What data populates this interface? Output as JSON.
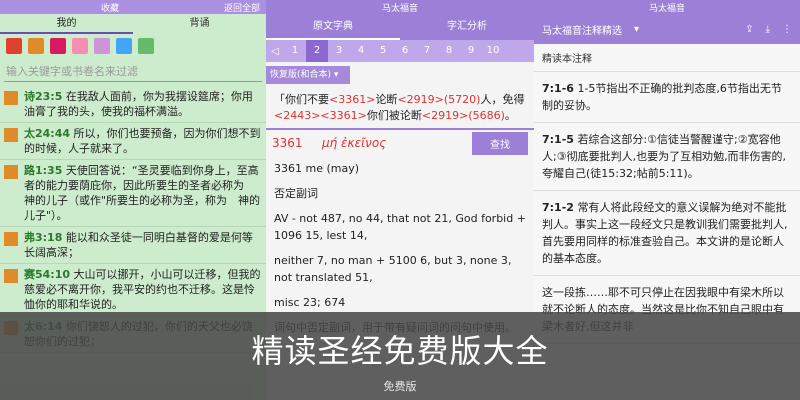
{
  "panel1": {
    "topbar_title": "收藏",
    "topbar_right": "返回全部",
    "tabs": [
      "我的",
      "背诵"
    ],
    "colors": [
      "#e04030",
      "#e08b2a",
      "#d81b60",
      "#f48fb1",
      "#ce93d8",
      "#42a5f5",
      "#66bb6a"
    ],
    "search_placeholder": "输入关键字或书卷名来过滤",
    "verses": [
      {
        "ref": "诗23:5",
        "text": "在我敌人面前，你为我摆设筵席；你用油膏了我的头，使我的福杯满溢。"
      },
      {
        "ref": "太24:44",
        "text": "所以，你们也要预备，因为你们想不到的时候，人子就来了。"
      },
      {
        "ref": "路1:35",
        "text": "天使回答说：“圣灵要临到你身上，至高者的能力要荫庇你，因此所要生的圣者必称为　神的儿子（或作\"所要生的必称为圣，称为　神的儿子\"）。"
      },
      {
        "ref": "弗3:18",
        "text": "能以和众圣徒一同明白基督的爱是何等长阔高深；"
      },
      {
        "ref": "赛54:10",
        "text": "大山可以挪开，小山可以迁移，但我的慈爱必不离开你，我平安的约也不迁移。这是怜恤你的耶和华说的。"
      },
      {
        "ref": "太6:14",
        "text": "你们饶恕人的过犯，你们的天父也必饶恕你们的过犯；"
      }
    ]
  },
  "panel2": {
    "topbar_title": "马太福音",
    "tabs": [
      "原文字典",
      "字汇分析"
    ],
    "pages": [
      "1",
      "2",
      "3",
      "4",
      "5",
      "6",
      "7",
      "8",
      "9",
      "10"
    ],
    "active_page": "2",
    "version": "恢复版(和合本)",
    "verse": {
      "prefix": "「你们不要",
      "tag1": "<3361>",
      "mid1": "论断",
      "tag2": "<2919>(5720)",
      "mid2": "人，免得",
      "tag3": "<2443><3361>",
      "mid3": "你们被论断",
      "tag4": "<2919>(5686)",
      "suffix": "。"
    },
    "lexicon": {
      "number": "3361",
      "greek": "μή ἐκεῖνος",
      "button": "查找",
      "lines": [
        "3361 me (may)",
        "否定副词",
        "AV - not 487, no 44, that not 21, God forbid + 1096 15, lest 14,",
        "neither 7, no man + 5100 6, but 3, none 3, not translated 51,",
        "misc 23; 674",
        "词句中否定副词，用于带有疑问词的问句中使用。"
      ]
    }
  },
  "panel3": {
    "topbar_title": "马太福音",
    "header_title": "马太福音注释精选",
    "subheader": "精读本注释",
    "notes": [
      {
        "ref": "7:1-6",
        "text": "1-5节指出不正确的批判态度,6节指出无节制的妥协。"
      },
      {
        "ref": "7:1-5",
        "text": "若综合这部分:①信徒当警醒谨守;②宽容他人;③彻底要批判人,也要为了互相劝勉,而非伤害的,夸耀自己(徒15:32;帖前5:11)。"
      },
      {
        "ref": "7:1-2",
        "text": "常有人将此段经文的意义误解为绝对不能批判人。事实上这一段经文只是教训我们需要批判人,首先要用同样的标准查验自己。本文讲的是论断人的基本态度。"
      },
      {
        "ref": "",
        "text": "这一段拣……耶不可只停止在因我眼中有梁木所以就不论断人的态度。当然这是比你不知自己眼中有梁木者好,但这并非"
      }
    ]
  },
  "overlay": {
    "title": "精读圣经免费版大全",
    "subtitle": "免费版"
  }
}
